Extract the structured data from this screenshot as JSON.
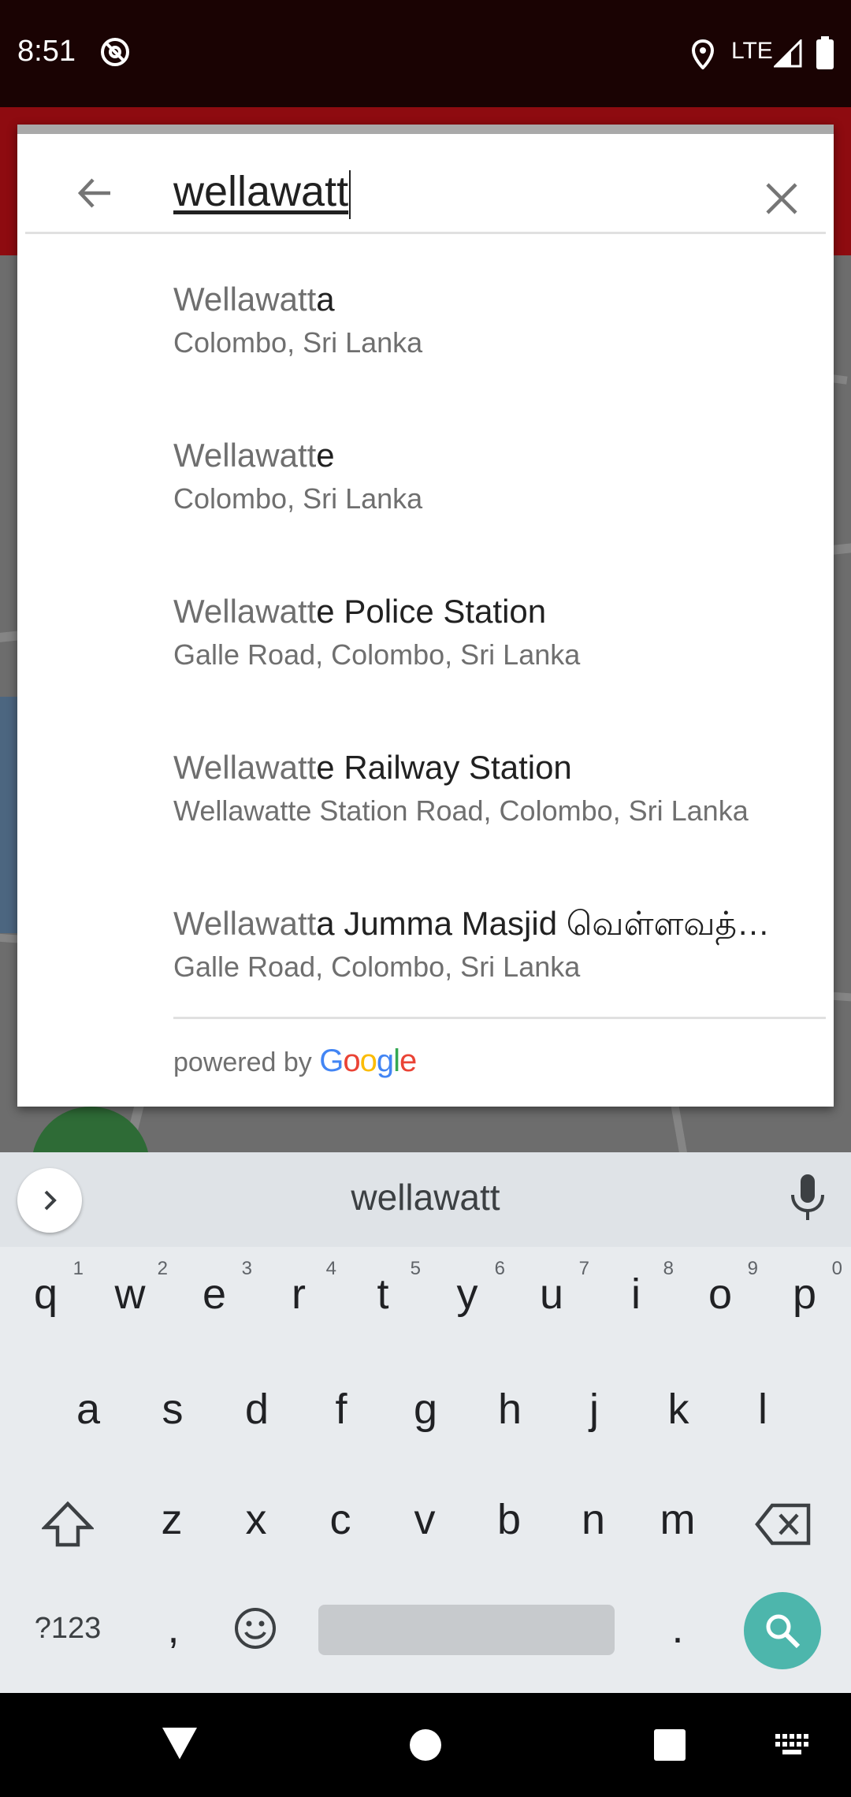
{
  "status_bar": {
    "time": "8:51",
    "network": "LTE"
  },
  "search": {
    "query": "wellawatt"
  },
  "results": [
    {
      "match": "Wellawatt",
      "rest": "a",
      "secondary": "Colombo, Sri Lanka"
    },
    {
      "match": "Wellawatt",
      "rest": "e",
      "secondary": "Colombo, Sri Lanka"
    },
    {
      "match": "Wellawatt",
      "rest": "e Police Station",
      "secondary": "Galle Road, Colombo, Sri Lanka"
    },
    {
      "match": "Wellawatt",
      "rest": "e Railway Station",
      "secondary": "Wellawatte Station Road, Colombo, Sri Lanka"
    },
    {
      "match": "Wellawatt",
      "rest": "a Jumma Masjid வெள்ளவத்…",
      "secondary": "Galle Road, Colombo, Sri Lanka"
    }
  ],
  "attribution": {
    "powered_by": "powered by",
    "brand": "Google"
  },
  "keyboard": {
    "suggestion": "wellawatt",
    "row1": [
      {
        "k": "q",
        "n": "1"
      },
      {
        "k": "w",
        "n": "2"
      },
      {
        "k": "e",
        "n": "3"
      },
      {
        "k": "r",
        "n": "4"
      },
      {
        "k": "t",
        "n": "5"
      },
      {
        "k": "y",
        "n": "6"
      },
      {
        "k": "u",
        "n": "7"
      },
      {
        "k": "i",
        "n": "8"
      },
      {
        "k": "o",
        "n": "9"
      },
      {
        "k": "p",
        "n": "0"
      }
    ],
    "row2": [
      "a",
      "s",
      "d",
      "f",
      "g",
      "h",
      "j",
      "k",
      "l"
    ],
    "row3": [
      "z",
      "x",
      "c",
      "v",
      "b",
      "n",
      "m"
    ],
    "symbols_key": "?123",
    "comma_key": ",",
    "period_key": "."
  },
  "colors": {
    "accent": "#4db6ac",
    "appbar": "#8e0b10",
    "google_blue": "#4285F4",
    "google_red": "#EA4335",
    "google_yellow": "#FBBC05",
    "google_green": "#34A853"
  }
}
